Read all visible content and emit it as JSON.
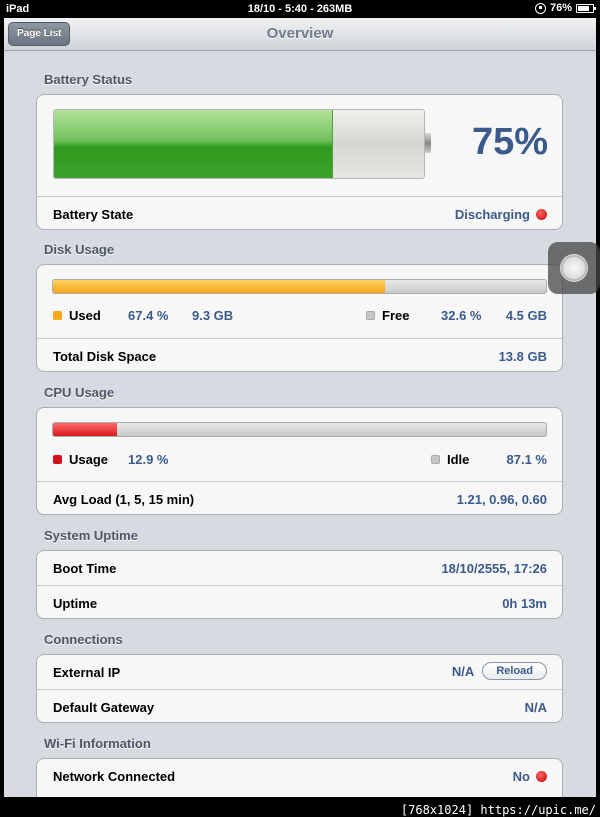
{
  "statusbar": {
    "device": "iPad",
    "center": "18/10 - 5:40 - 263MB",
    "battery": "76%",
    "battery_level": 0.76
  },
  "navbar": {
    "back_label": "Page List",
    "title": "Overview"
  },
  "battery": {
    "section_title": "Battery Status",
    "percent": "75%",
    "level": 0.75,
    "state_label": "Battery State",
    "state_value": "Discharging"
  },
  "disk": {
    "section_title": "Disk Usage",
    "used_fraction": 0.674,
    "used_label": "Used",
    "used_pct": "67.4 %",
    "used_size": "9.3 GB",
    "free_label": "Free",
    "free_pct": "32.6 %",
    "free_size": "4.5 GB",
    "total_label": "Total Disk Space",
    "total_value": "13.8 GB"
  },
  "cpu": {
    "section_title": "CPU Usage",
    "usage_fraction": 0.129,
    "usage_label": "Usage",
    "usage_pct": "12.9 %",
    "idle_label": "Idle",
    "idle_pct": "87.1 %",
    "load_label": "Avg Load (1, 5, 15 min)",
    "load_value": "1.21, 0.96, 0.60"
  },
  "uptime": {
    "section_title": "System Uptime",
    "boot_label": "Boot Time",
    "boot_value": "18/10/2555, 17:26",
    "uptime_label": "Uptime",
    "uptime_value": "0h 13m"
  },
  "connections": {
    "section_title": "Connections",
    "ip_label": "External IP",
    "ip_value": "N/A",
    "reload_label": "Reload",
    "gateway_label": "Default Gateway",
    "gateway_value": "N/A"
  },
  "wifi": {
    "section_title": "Wi-Fi Information",
    "connected_label": "Network Connected",
    "connected_value": "No"
  },
  "watermark": "[768x1024] https://upic.me/",
  "colors": {
    "accent_value": "#3b5a8c",
    "battery_green": "#3ba32a",
    "disk_orange": "#f4a615",
    "cpu_red": "#d81a1a",
    "status_red": "#c40000"
  }
}
